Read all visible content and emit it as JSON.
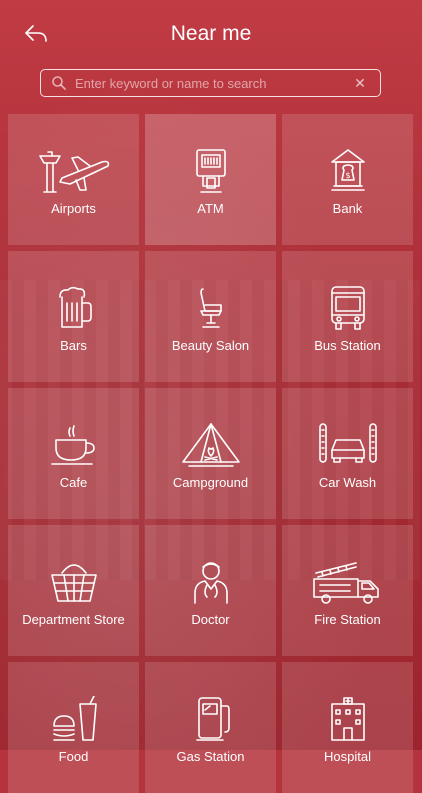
{
  "header": {
    "title": "Near me"
  },
  "search": {
    "placeholder": "Enter keyword or name to search"
  },
  "categories": [
    {
      "label": "Airports"
    },
    {
      "label": "ATM"
    },
    {
      "label": "Bank"
    },
    {
      "label": "Bars"
    },
    {
      "label": "Beauty Salon"
    },
    {
      "label": "Bus Station"
    },
    {
      "label": "Cafe"
    },
    {
      "label": "Campground"
    },
    {
      "label": "Car Wash"
    },
    {
      "label": "Department Store"
    },
    {
      "label": "Doctor"
    },
    {
      "label": "Fire Station"
    },
    {
      "label": "Food"
    },
    {
      "label": "Gas Station"
    },
    {
      "label": "Hospital"
    }
  ]
}
